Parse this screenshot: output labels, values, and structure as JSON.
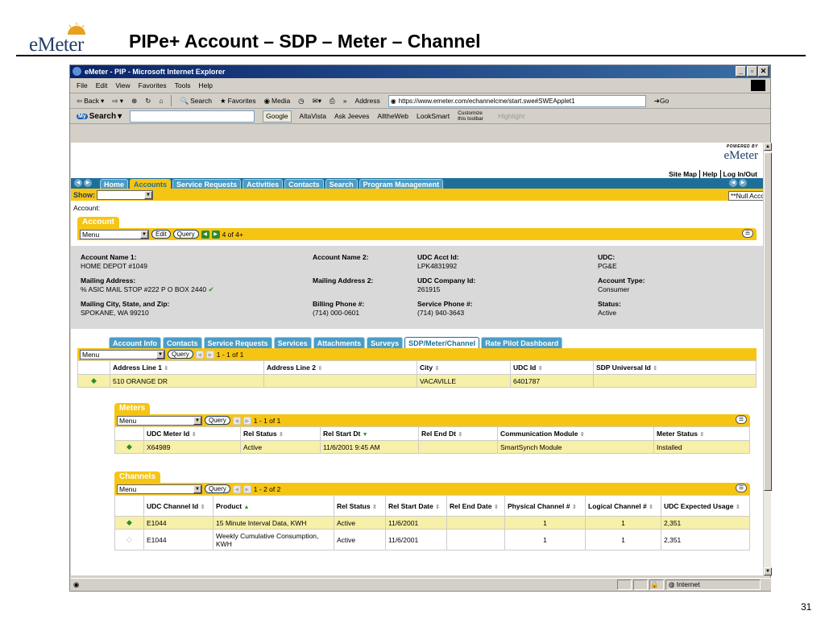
{
  "slide": {
    "logo_text": "eMeter",
    "title": "PIPe+  Account – SDP – Meter – Channel",
    "page_number": "31"
  },
  "browser": {
    "title": "eMeter - PIP - Microsoft Internet Explorer",
    "menu": [
      "File",
      "Edit",
      "View",
      "Favorites",
      "Tools",
      "Help"
    ],
    "toolbar": {
      "back": "Back",
      "search": "Search",
      "favorites": "Favorites",
      "media": "Media",
      "address_label": "Address",
      "address_url": "https://www.emeter.com/echannelcme/start.swe#SWEApplet1",
      "go": "Go"
    },
    "google_bar": {
      "brand": "Search",
      "google_btn": "Google",
      "links": [
        "AltaVista",
        "Ask Jeeves",
        "AlltheWeb",
        "LookSmart"
      ],
      "customize": "Customize this toolbar",
      "highlight": "Highlight"
    },
    "status": {
      "zone": "Internet"
    }
  },
  "app": {
    "powered_by": "POWERED BY",
    "brand": "eMeter",
    "util_links": [
      "Site Map",
      "Help",
      "Log In/Out"
    ],
    "nav_tabs": [
      "Home",
      "Accounts",
      "Service Requests",
      "Activities",
      "Contacts",
      "Search",
      "Program Management"
    ],
    "active_nav": "Accounts",
    "show_label": "Show:",
    "show_value": "",
    "right_select": "**Null Accounts (eMeter)",
    "breadcrumb": "Account:"
  },
  "account": {
    "section_title": "Account",
    "menu": "Menu",
    "edit": "Edit",
    "query": "Query",
    "record_count": "4 of 4+",
    "fields": {
      "name1_label": "Account Name 1:",
      "name1": "HOME DEPOT #1049",
      "mail_label": "Mailing Address:",
      "mail": "% ASIC MAIL STOP #222 P O BOX 2440",
      "city_label": "Mailing City, State, and Zip:",
      "city": "SPOKANE, WA 99210",
      "name2_label": "Account Name 2:",
      "mail2_label": "Mailing Address 2:",
      "billing_label": "Billing Phone #:",
      "billing": "(714) 000-0601",
      "udc_acct_label": "UDC Acct Id:",
      "udc_acct": "LPK4831992",
      "udc_company_label": "UDC Company Id:",
      "udc_company": "261915",
      "service_phone_label": "Service Phone #:",
      "service_phone": "(714) 940-3643",
      "udc_label": "UDC:",
      "udc": "PG&E",
      "type_label": "Account Type:",
      "type": "Consumer",
      "status_label": "Status:",
      "status": "Active"
    }
  },
  "sub_tabs": [
    "Account Info",
    "Contacts",
    "Service Requests",
    "Services",
    "Attachments",
    "Surveys",
    "SDP/Meter/Channel",
    "Rate Pilot Dashboard"
  ],
  "active_sub_tab": "SDP/Meter/Channel",
  "sdp": {
    "menu": "Menu",
    "query": "Query",
    "record_count": "1 - 1 of 1",
    "columns": [
      "Address Line 1",
      "Address Line 2",
      "City",
      "UDC Id",
      "SDP Universal Id"
    ],
    "rows": [
      [
        "510 ORANGE DR",
        "",
        "VACAVILLE",
        "6401787",
        ""
      ]
    ]
  },
  "meters": {
    "title": "Meters",
    "menu": "Menu",
    "query": "Query",
    "record_count": "1 - 1 of 1",
    "columns": [
      "UDC Meter Id",
      "Rel Status",
      "Rel Start Dt",
      "Rel End Dt",
      "Communication Module",
      "Meter Status"
    ],
    "rows": [
      [
        "X64989",
        "Active",
        "11/6/2001 9:45 AM",
        "",
        "SmartSynch Module",
        "Installed"
      ]
    ]
  },
  "channels": {
    "title": "Channels",
    "menu": "Menu",
    "query": "Query",
    "record_count": "1 - 2 of 2",
    "columns": [
      "UDC Channel Id",
      "Product",
      "Rel Status",
      "Rel Start Date",
      "Rel End Date",
      "Physical Channel #",
      "Logical Channel #",
      "UDC Expected Usage"
    ],
    "rows": [
      [
        "E1044",
        "15 Minute Interval Data, KWH",
        "Active",
        "11/6/2001",
        "",
        "1",
        "1",
        "2,351"
      ],
      [
        "E1044",
        "Weekly Cumulative Consumption, KWH",
        "Active",
        "11/6/2001",
        "",
        "1",
        "1",
        "2,351"
      ]
    ]
  },
  "colors": {
    "yellow": "#f6c513",
    "nav_blue": "#1d6f99",
    "tab_blue": "#4a9dc8",
    "form_gray": "#d9d9d9"
  }
}
